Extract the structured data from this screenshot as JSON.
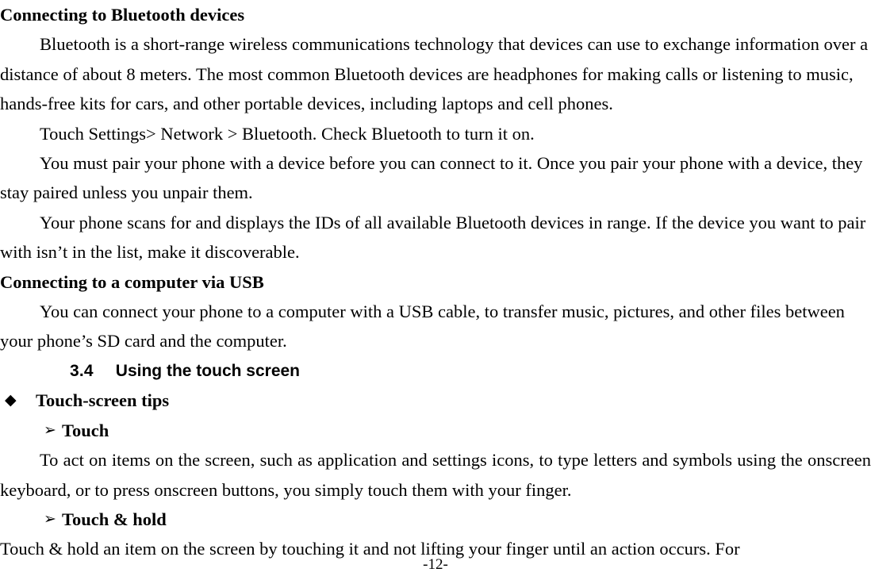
{
  "document": {
    "page_number_label": "-12-",
    "blocks": [
      {
        "kind": "heading_bold",
        "text": "Connecting to Bluetooth devices"
      },
      {
        "kind": "paragraph",
        "text": "Bluetooth is a short-range wireless communications technology that devices can use to exchange information over a distance of about 8 meters. The most common Bluetooth devices are headphones for making calls or listening to music, hands-free kits for cars, and other portable devices, including laptops and cell phones."
      },
      {
        "kind": "paragraph",
        "text": "Touch Settings> Network > Bluetooth. Check Bluetooth to turn it on."
      },
      {
        "kind": "paragraph",
        "text": "You must pair your phone with a device before you can connect to it. Once you pair your phone with a device, they stay paired unless you unpair them."
      },
      {
        "kind": "paragraph",
        "text": "Your phone scans for and displays the IDs of all available Bluetooth devices in range. If the device you want to pair with isn’t in the list, make it discoverable."
      },
      {
        "kind": "heading_bold",
        "text": "Connecting to a computer via USB"
      },
      {
        "kind": "paragraph",
        "text": "You can connect your phone to a computer with a USB cable, to transfer music, pictures, and other files between your phone’s SD card and the computer."
      },
      {
        "kind": "section_heading",
        "number": "3.4",
        "title": "Using the touch screen"
      },
      {
        "kind": "bullet_level1",
        "marker": "diamond-bullet-icon",
        "marker_glyph": "◆",
        "text": "Touch-screen tips"
      },
      {
        "kind": "bullet_level2",
        "marker": "arrow-bullet-icon",
        "marker_glyph": "➢",
        "text": "Touch"
      },
      {
        "kind": "paragraph_justified",
        "text": "To act on items on the screen, such as application and settings icons, to type letters and symbols using the onscreen keyboard, or to press onscreen buttons, you simply touch them with your finger."
      },
      {
        "kind": "bullet_level2",
        "marker": "arrow-bullet-icon",
        "marker_glyph": "➢",
        "text": "Touch & hold"
      },
      {
        "kind": "paragraph_noindent",
        "text": "Touch & hold an item on the screen by touching it and not lifting your finger until an action occurs. For"
      }
    ]
  }
}
